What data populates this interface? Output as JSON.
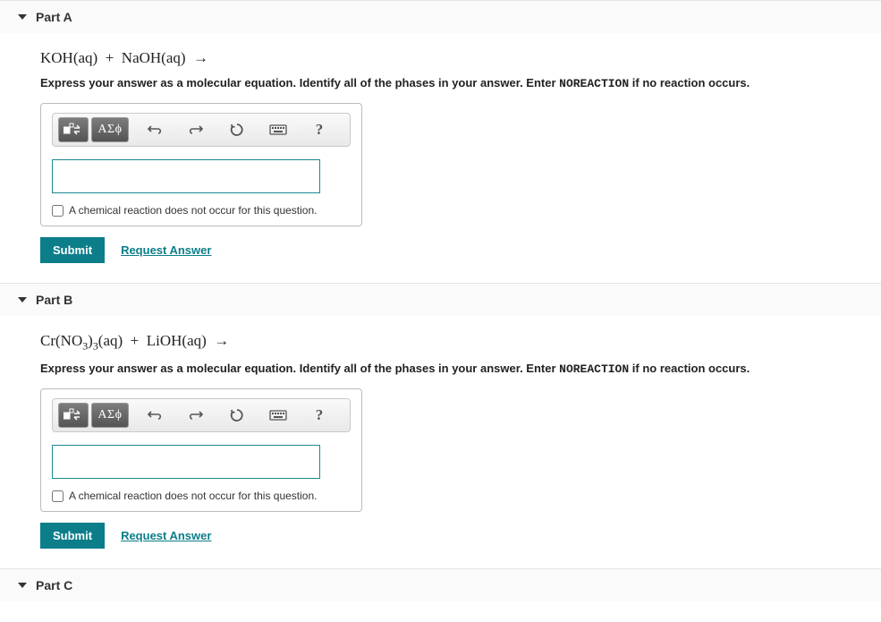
{
  "parts": [
    {
      "title": "Part A",
      "equation_html": "KOH(aq) &nbsp;+&nbsp; NaOH(aq) &nbsp;&rarr;",
      "instructions_pre": "Express your answer as a molecular equation. Identify all of the phases in your answer. Enter ",
      "instructions_code": "NOREACTION",
      "instructions_post": " if no reaction occurs.",
      "greek_label": "ΑΣϕ",
      "checkbox_label": "A chemical reaction does not occur for this question.",
      "submit_label": "Submit",
      "request_label": "Request Answer",
      "help_label": "?"
    },
    {
      "title": "Part B",
      "equation_html": "Cr(NO<sub>3</sub>)<sub>3</sub>(aq) &nbsp;+&nbsp; LiOH(aq) &nbsp;&rarr;",
      "instructions_pre": "Express your answer as a molecular equation. Identify all of the phases in your answer. Enter ",
      "instructions_code": "NOREACTION",
      "instructions_post": " if no reaction occurs.",
      "greek_label": "ΑΣϕ",
      "checkbox_label": "A chemical reaction does not occur for this question.",
      "submit_label": "Submit",
      "request_label": "Request Answer",
      "help_label": "?"
    },
    {
      "title": "Part C"
    }
  ]
}
